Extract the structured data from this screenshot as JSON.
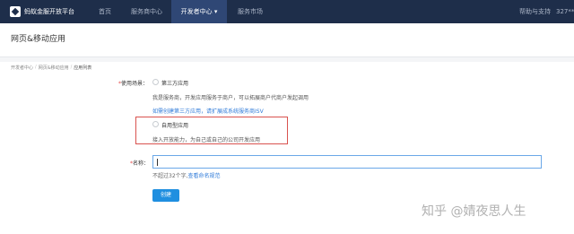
{
  "nav": {
    "brand": "蚂蚁金服开放平台",
    "items": [
      "首页",
      "服务商中心",
      "开发者中心 ▾",
      "服务市场"
    ],
    "help": "帮助与支持",
    "user": "327**"
  },
  "page": {
    "title": "网页&移动应用"
  },
  "breadcrumb": [
    "开发者中心",
    "网页&移动应用",
    "应用列表"
  ],
  "form": {
    "scenario_label": "使用场景：",
    "required_mark": "*",
    "option_third_party": {
      "label": "第三方应用",
      "desc": "我是服务商，开发应用服务于商户，可以拓展商户代商户发起调用",
      "link": "如需创建第三方应用，请扩展成系统服务商ISV"
    },
    "option_self": {
      "label": "自用型应用",
      "desc": "接入开放能力，为自己或自己的公司开发应用"
    },
    "name_label": "名称：",
    "name_value": "",
    "hint_prefix": "不超过32个字,",
    "hint_link": "查看命名规范",
    "create_label": "创建"
  },
  "watermark": "知乎 @婧夜思人生"
}
